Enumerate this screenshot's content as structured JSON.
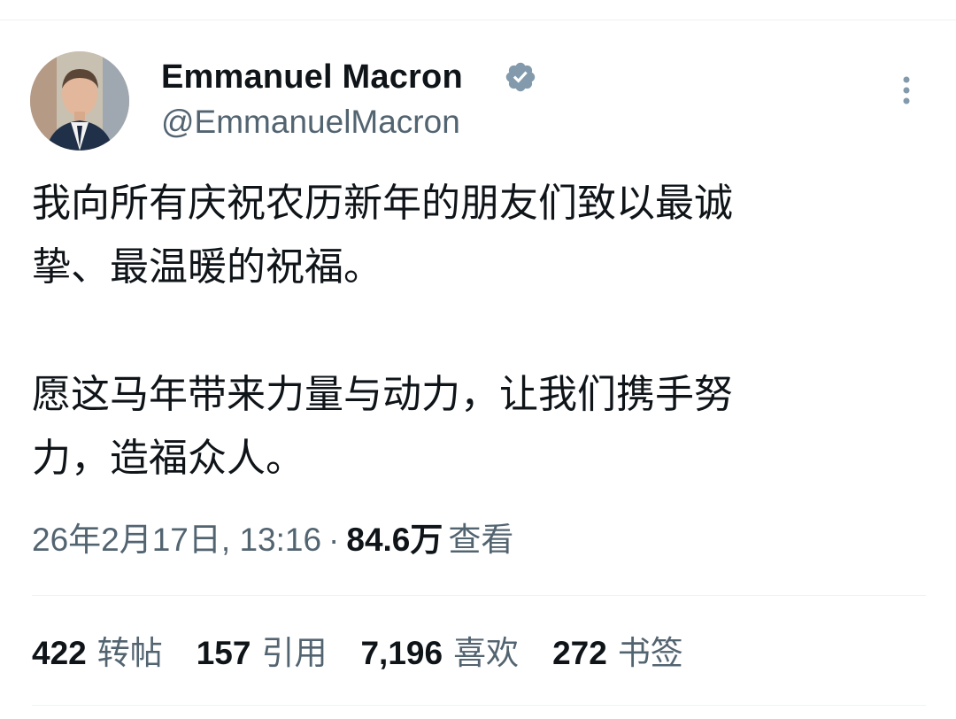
{
  "author": {
    "display_name": "Emmanuel Macron",
    "handle": "@EmmanuelMacron",
    "verified_color": "#829aab",
    "avatar_icon": "profile-photo"
  },
  "tweet": {
    "lines": [
      "我向所有庆祝农历新年的朋友们致以最诚",
      "挚、最温暖的祝福。",
      "",
      "愿这马年带来力量与动力，让我们携手努",
      "力，造福众人。"
    ]
  },
  "meta": {
    "timestamp": "26年2月17日, 13:16",
    "separator": "·",
    "views": "84.6万",
    "views_label": "查看"
  },
  "stats": [
    {
      "count": "422",
      "label": "转帖"
    },
    {
      "count": "157",
      "label": "引用"
    },
    {
      "count": "7,196",
      "label": "喜欢"
    },
    {
      "count": "272",
      "label": "书签"
    }
  ],
  "colors": {
    "text": "#0f1419",
    "secondary": "#536471",
    "divider": "#eff3f4",
    "verified_badge": "#829aab"
  }
}
